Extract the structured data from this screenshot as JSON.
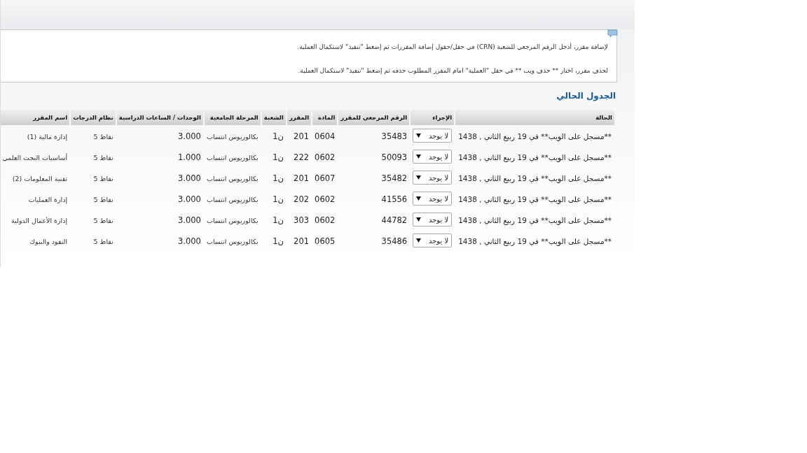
{
  "instructions": [
    "لإضافة مقرر، أدخل الرقم المرجعي للشعبة (CRN) في حقل/حقول إضافة المقررات ثم إضغط \"تنفيذ\" لاستكمال العملية.",
    "لحذف مقرر، اختار ** حذف ويب ** في حقل \"العملية\" امام المقرر المطلوب حذفه ثم إضغط \"تنفيذ\" لاستكمال العملية."
  ],
  "section_title": "الجدول الحالي",
  "table": {
    "columns": [
      "الحالة",
      "الإجراء",
      "الرقم المرجعي للمقرر",
      "المادة",
      "المقرر",
      "الشعبة",
      "المرحلة الجامعية",
      "الوحدات / الساعات الدراسية",
      "نظام الدرجات",
      "اسم المقرر"
    ],
    "rows": [
      {
        "status": "**مسجل على الويب** في 19 ربيع الثاني , 1438",
        "action": "لا يوجد",
        "crn": "35483",
        "subject": "0604",
        "course": "201",
        "section": "ن1",
        "level": "بكالوريوس انتساب",
        "units": "3.000",
        "grading": "نقاط 5",
        "title": "إدارة مالية (1)"
      },
      {
        "status": "**مسجل على الويب** في 19 ربيع الثاني , 1438",
        "action": "لا يوجد",
        "crn": "50093",
        "subject": "0602",
        "course": "222",
        "section": "ن1",
        "level": "بكالوريوس انتساب",
        "units": "1.000",
        "grading": "نقاط 5",
        "title": "أساسيات البحث العلمي"
      },
      {
        "status": "**مسجل على الويب** في 19 ربيع الثاني , 1438",
        "action": "لا يوجد",
        "crn": "35482",
        "subject": "0607",
        "course": "201",
        "section": "ن1",
        "level": "بكالوريوس انتساب",
        "units": "3.000",
        "grading": "نقاط 5",
        "title": "تقنية المعلومات (2)"
      },
      {
        "status": "**مسجل على الويب** في 19 ربيع الثاني , 1438",
        "action": "لا يوجد",
        "crn": "41556",
        "subject": "0602",
        "course": "202",
        "section": "ن1",
        "level": "بكالوريوس انتساب",
        "units": "3.000",
        "grading": "نقاط 5",
        "title": "إدارة العمليات"
      },
      {
        "status": "**مسجل على الويب** في 19 ربيع الثاني , 1438",
        "action": "لا يوجد",
        "crn": "44782",
        "subject": "0602",
        "course": "303",
        "section": "ن1",
        "level": "بكالوريوس انتساب",
        "units": "3.000",
        "grading": "نقاط 5",
        "title": "إدارة الأعمال الدولية"
      },
      {
        "status": "**مسجل على الويب** في 19 ربيع الثاني , 1438",
        "action": "لا يوجد",
        "crn": "35486",
        "subject": "0605",
        "course": "201",
        "section": "ن1",
        "level": "بكالوريوس انتساب",
        "units": "3.000",
        "grading": "نقاط 5",
        "title": "النقود والبنوك"
      }
    ]
  }
}
